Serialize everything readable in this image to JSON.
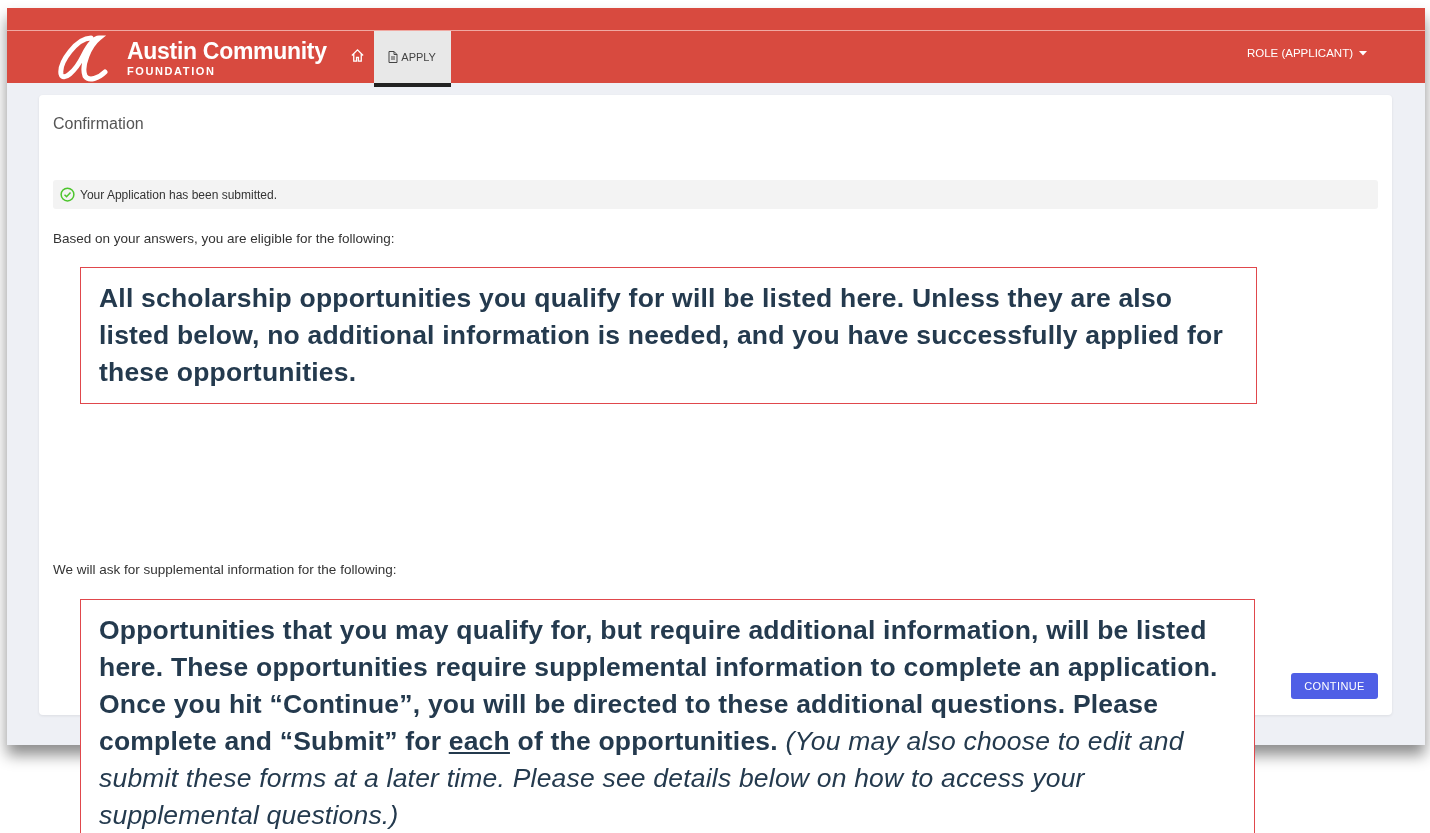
{
  "header": {
    "brand": {
      "name": "Austin Community",
      "tagline": "FOUNDATION"
    },
    "tabs": [
      {
        "kind": "home",
        "selected": false
      },
      {
        "kind": "apply",
        "label": "APPLY",
        "selected": true
      }
    ],
    "role_menu": {
      "label": "ROLE (APPLICANT)"
    }
  },
  "card": {
    "title": "Confirmation",
    "alert": {
      "text": "Your Application has been submitted."
    },
    "eligible_text": "Based on your answers, you are eligible for the following:",
    "supplemental_text": "We will ask for supplemental information for the following:",
    "continue_button": "CONTINUE"
  },
  "callouts": [
    {
      "segments": [
        {
          "kind": "plain",
          "text": "All scholarship opportunities you qualify for will be listed here. Unless they are also listed below, no additional information is needed, and you have successfully applied for these opportunities."
        }
      ]
    },
    {
      "segments": [
        {
          "kind": "plain",
          "text": "Opportunities that you may qualify for, but require additional information, will be listed here. These opportunities require supplemental information to complete an application. Once you hit “Continue”, you will be directed to these additional questions. Please complete and “Submit” for "
        },
        {
          "kind": "underline",
          "text": "each"
        },
        {
          "kind": "plain",
          "text": " of the opportunities. "
        },
        {
          "kind": "italic",
          "text": "(You may also choose to edit and submit these forms at a later time. Please see details below on how to access your supplemental questions.)"
        }
      ]
    }
  ]
}
